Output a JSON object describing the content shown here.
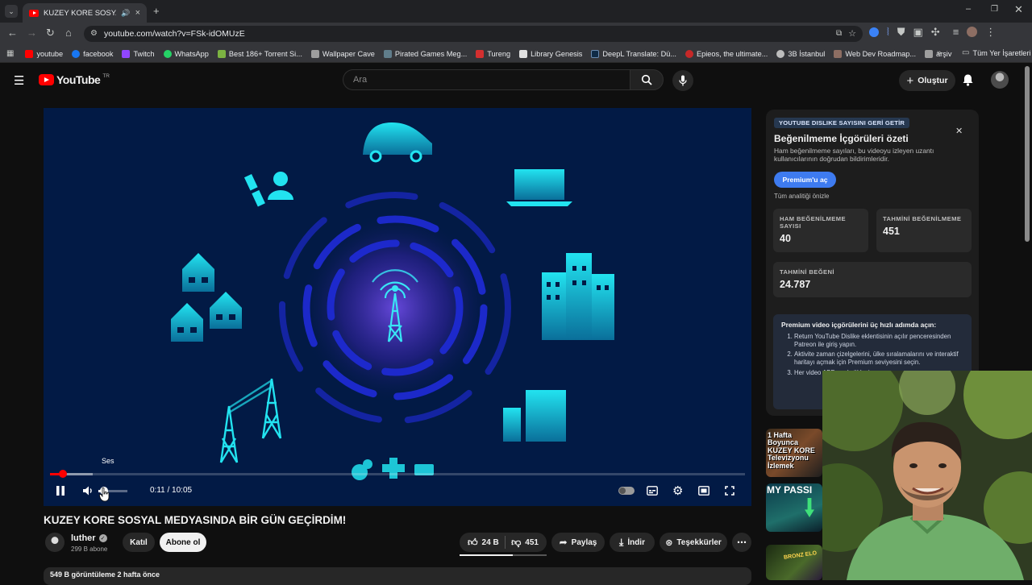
{
  "browser": {
    "tab_title": "KUZEY KORE SOSYAL MEDY",
    "url": "youtube.com/watch?v=FSk-idOMUzE",
    "bookmarks": [
      {
        "label": "youtube",
        "color": "#ff0000"
      },
      {
        "label": "facebook",
        "color": "#1877f2"
      },
      {
        "label": "Twitch",
        "color": "#9146ff"
      },
      {
        "label": "WhatsApp",
        "color": "#25d366"
      },
      {
        "label": "Best 186+ Torrent Si...",
        "color": "#7cb342"
      },
      {
        "label": "Wallpaper Cave",
        "color": "#9e9e9e"
      },
      {
        "label": "Pirated Games Meg...",
        "color": "#607d8b"
      },
      {
        "label": "Tureng",
        "color": "#d32f2f"
      },
      {
        "label": "Library Genesis",
        "color": "#e0e0e0"
      },
      {
        "label": "DeepL Translate: Dü...",
        "color": "#0f2b46"
      },
      {
        "label": "Epieos, the ultimate...",
        "color": "#c62828"
      },
      {
        "label": "3B İstanbul",
        "color": "#bdbdbd"
      },
      {
        "label": "Web Dev Roadmap...",
        "color": "#8d6e63"
      },
      {
        "label": "arşiv",
        "color": "#9e9e9e"
      }
    ],
    "all_bookmarks": "Tüm Yer İşaretleri"
  },
  "header": {
    "logo_text": "YouTube",
    "logo_country": "TR",
    "search_placeholder": "Ara",
    "create_label": "Oluştur"
  },
  "player": {
    "tooltip": "Ses",
    "time": "0:11 / 10:05",
    "progress_fraction": 0.018,
    "buffered_fraction": 0.062,
    "volume_fraction": 0.15
  },
  "video": {
    "title": "KUZEY KORE SOSYAL MEDYASINDA BİR GÜN GEÇİRDİM!",
    "channel": "luther",
    "subscribers": "299 B abone",
    "join_label": "Katıl",
    "subscribe_label": "Abone ol",
    "likes": "24 B",
    "dislikes": "451",
    "like_ratio": 0.61,
    "share_label": "Paylaş",
    "download_label": "İndir",
    "thanks_label": "Teşekkürler",
    "description_peek": "549 B görüntüleme  2 hafta önce"
  },
  "panel": {
    "badge": "YOUTUBE DISLIKE SAYISINI GERİ GETİR",
    "title": "Beğenilmeme İçgörüleri özeti",
    "description": "Ham beğenilmeme sayıları, bu videoyu izleyen uzantı kullanıcılarının doğrudan bildirimleridir.",
    "premium_button": "Premium'u aç",
    "preview_note": "Tüm analitiği önizle",
    "stats": [
      {
        "label": "HAM BEĞENİLMEME SAYISI",
        "value": "40"
      },
      {
        "label": "TAHMİNİ BEĞENİLMEME",
        "value": "451"
      },
      {
        "label": "TAHMİNİ BEĞENİ",
        "value": "24.787"
      }
    ],
    "steps_title": "Premium video içgörülerini üç hızlı adımda açın:",
    "steps": [
      "Return YouTube Dislike eklentisinin açılır penceresinden Patreon ile giriş yapın.",
      "Aktivite zaman çizelgelerini, ülke sıralamalarını ve interaktif haritayı açmak için Premium seviyesini seçin.",
      "Her video ABD eyal yükleyin."
    ]
  },
  "thumbnails": [
    {
      "text": "1 Hafta Boyunca KUZEY KORE Televizyonu İzlemek"
    },
    {
      "text": "MY PASSI"
    },
    {
      "text": "BRONZ ELO"
    }
  ]
}
